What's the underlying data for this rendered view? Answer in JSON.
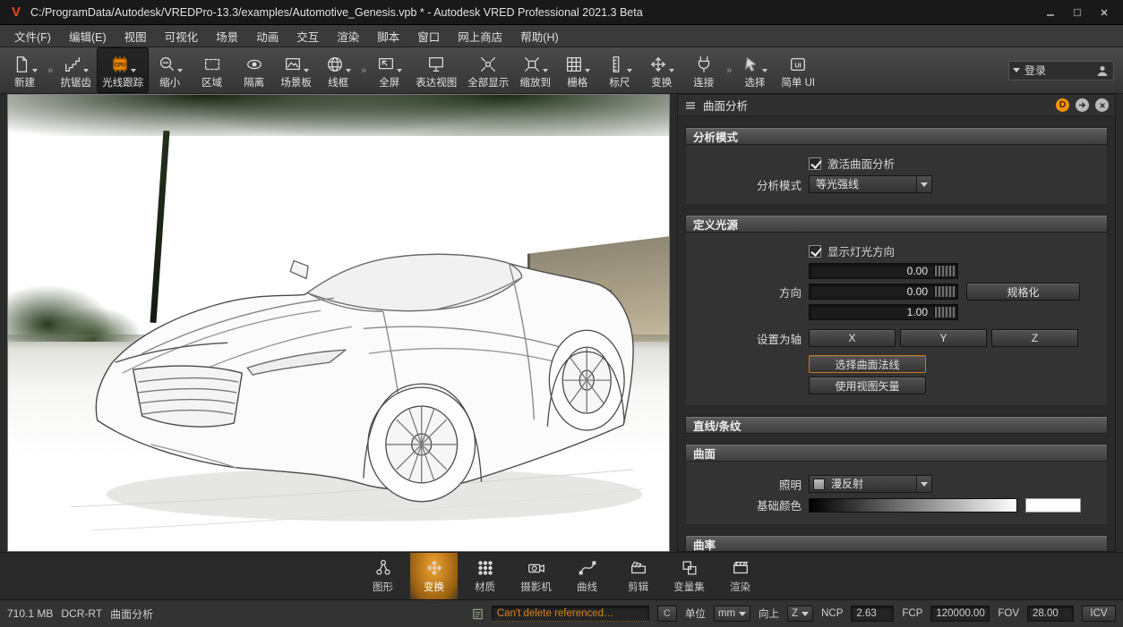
{
  "window": {
    "logo": "V",
    "title": "C:/ProgramData/Autodesk/VREDPro-13.3/examples/Automotive_Genesis.vpb * - Autodesk VRED Professional 2021.3 Beta"
  },
  "menu": {
    "items": [
      "文件(F)",
      "编辑(E)",
      "视图",
      "可视化",
      "场景",
      "动画",
      "交互",
      "渲染",
      "脚本",
      "窗口",
      "网上商店",
      "帮助(H)"
    ]
  },
  "toolbar": {
    "cpu_label": "CPU",
    "ui_label": "UI",
    "login_label": "登录",
    "items": [
      {
        "label": "新建",
        "icon": "new-file",
        "arrow": true,
        "active": false
      },
      {
        "label": "抗锯齿",
        "icon": "antialias",
        "arrow": true,
        "active": false
      },
      {
        "label": "光线跟踪",
        "icon": "raytrace-cpu",
        "arrow": true,
        "active": true
      },
      {
        "label": "缩小",
        "icon": "zoom-out",
        "arrow": true,
        "active": false
      },
      {
        "label": "区域",
        "icon": "region",
        "arrow": false,
        "active": false
      },
      {
        "label": "隔离",
        "icon": "isolate",
        "arrow": false,
        "active": false
      },
      {
        "label": "场景板",
        "icon": "sceneplate",
        "arrow": true,
        "active": false
      },
      {
        "label": "线框",
        "icon": "wireframe",
        "arrow": true,
        "active": false
      },
      {
        "label": "全屏",
        "icon": "fullscreen",
        "arrow": true,
        "active": false
      },
      {
        "label": "表达视图",
        "icon": "render-view",
        "arrow": false,
        "active": false
      },
      {
        "label": "全部显示",
        "icon": "show-all",
        "arrow": false,
        "active": false
      },
      {
        "label": "缩放到",
        "icon": "zoom-to",
        "arrow": true,
        "active": false
      },
      {
        "label": "栅格",
        "icon": "grid",
        "arrow": true,
        "active": false
      },
      {
        "label": "标尺",
        "icon": "ruler",
        "arrow": true,
        "active": false
      },
      {
        "label": "变换",
        "icon": "transform",
        "arrow": true,
        "active": false
      },
      {
        "label": "连接",
        "icon": "connect",
        "arrow": false,
        "active": false
      },
      {
        "label": "选择",
        "icon": "select",
        "arrow": true,
        "active": false
      },
      {
        "label": "简单 UI",
        "icon": "simple-ui",
        "arrow": false,
        "active": false
      }
    ]
  },
  "panel": {
    "title": "曲面分析",
    "d_badge": "D",
    "analysis_mode": {
      "title": "分析模式",
      "activate_label": "激活曲面分析",
      "activate_checked": true,
      "mode_label": "分析模式",
      "mode_value": "等光强线"
    },
    "light_source": {
      "title": "定义光源",
      "show_direction_label": "显示灯光方向",
      "show_direction_checked": true,
      "direction_label": "方向",
      "values": [
        "0.00",
        "0.00",
        "1.00"
      ],
      "normalize_label": "规格化",
      "axis_label": "设置为轴",
      "axis_buttons": [
        "X",
        "Y",
        "Z"
      ],
      "select_normals_label": "选择曲面法线",
      "use_view_vector_label": "使用视图矢量"
    },
    "lines": {
      "title": "直线/条纹"
    },
    "surface": {
      "title": "曲面",
      "lighting_label": "照明",
      "lighting_value": "漫反射",
      "base_color_label": "基础颜色",
      "base_color_swatch": "#ffffff"
    },
    "curvature": {
      "title": "曲率"
    },
    "accent_color": "#e8820c"
  },
  "bottom_toolbar": {
    "items": [
      {
        "label": "图形",
        "icon": "scenegraph",
        "active": false
      },
      {
        "label": "变换",
        "icon": "transform",
        "active": true
      },
      {
        "label": "材质",
        "icon": "material",
        "active": false
      },
      {
        "label": "摄影机",
        "icon": "camera",
        "active": false
      },
      {
        "label": "曲线",
        "icon": "curve",
        "active": false
      },
      {
        "label": "剪辑",
        "icon": "clip",
        "active": false
      },
      {
        "label": "变量集",
        "icon": "variant-set",
        "active": false
      },
      {
        "label": "渲染",
        "icon": "render",
        "active": false
      }
    ]
  },
  "statusbar": {
    "memory": "710.1 MB",
    "mode": "DCR-RT",
    "tool": "曲面分析",
    "message": "Can't delete referenced…",
    "c_button": "C",
    "unit_label": "单位",
    "unit_value": "mm",
    "up_label": "向上",
    "up_value": "Z",
    "ncp_label": "NCP",
    "ncp_value": "2.63",
    "fcp_label": "FCP",
    "fcp_value": "120000.00",
    "fov_label": "FOV",
    "fov_value": "28.00",
    "icv_label": "ICV"
  }
}
